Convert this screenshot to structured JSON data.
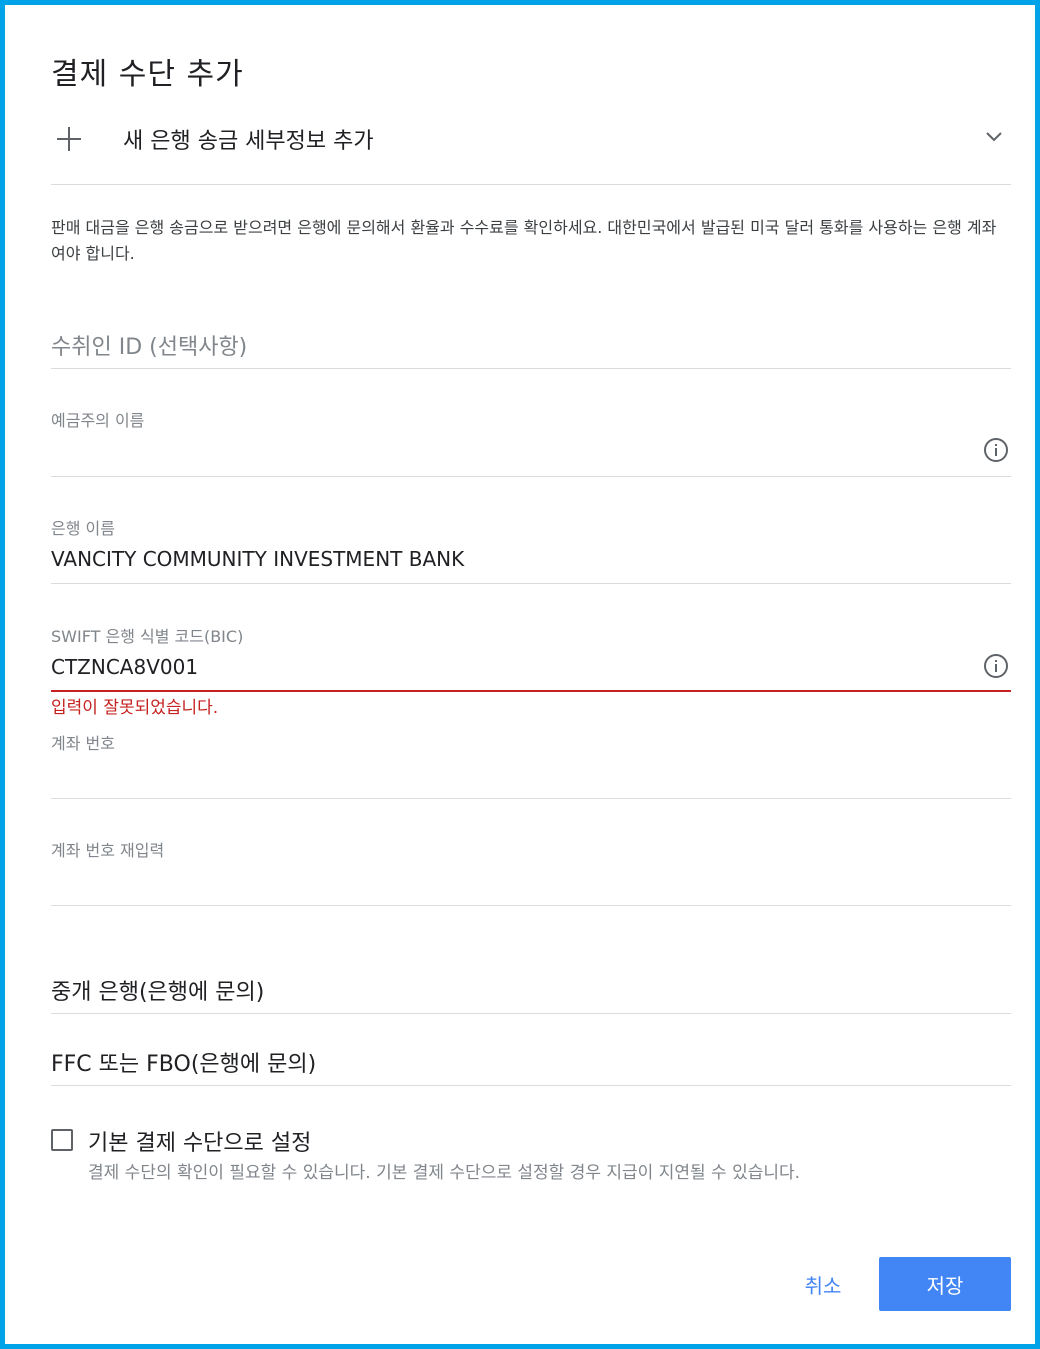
{
  "dialog": {
    "title": "결제 수단 추가",
    "add_bank_label": "새 은행 송금 세부정보 추가",
    "info": "판매 대금을 은행 송금으로 받으려면 은행에 문의해서 환율과 수수료를 확인하세요. 대한민국에서 발급된 미국 달러 통화를 사용하는 은행 계좌여야 합니다."
  },
  "fields": {
    "recipient_id": {
      "placeholder": "수취인 ID (선택사항)"
    },
    "account_holder": {
      "label": "예금주의 이름",
      "value": ""
    },
    "bank_name": {
      "label": "은행 이름",
      "value": "VANCITY COMMUNITY INVESTMENT BANK"
    },
    "swift": {
      "label": "SWIFT 은행 식별 코드(BIC)",
      "value": "CTZNCA8V001",
      "error": "입력이 잘못되었습니다."
    },
    "account_number": {
      "label": "계좌 번호",
      "value": ""
    },
    "account_number_confirm": {
      "label": "계좌 번호 재입력",
      "value": ""
    },
    "intermediary_bank": {
      "label": "중개 은행(은행에 문의)"
    },
    "ffc_fbo": {
      "label": "FFC 또는 FBO(은행에 문의)"
    }
  },
  "default_option": {
    "label": "기본 결제 수단으로 설정",
    "note": "결제 수단의 확인이 필요할 수 있습니다. 기본 결제 수단으로 설정할 경우 지급이 지연될 수 있습니다.",
    "checked": false
  },
  "buttons": {
    "cancel": "취소",
    "save": "저장"
  },
  "colors": {
    "frame": "#00a2e8",
    "accent": "#4285f4",
    "error": "#c5221f"
  },
  "icons": [
    "plus-icon",
    "chevron-down-icon",
    "info-icon"
  ]
}
